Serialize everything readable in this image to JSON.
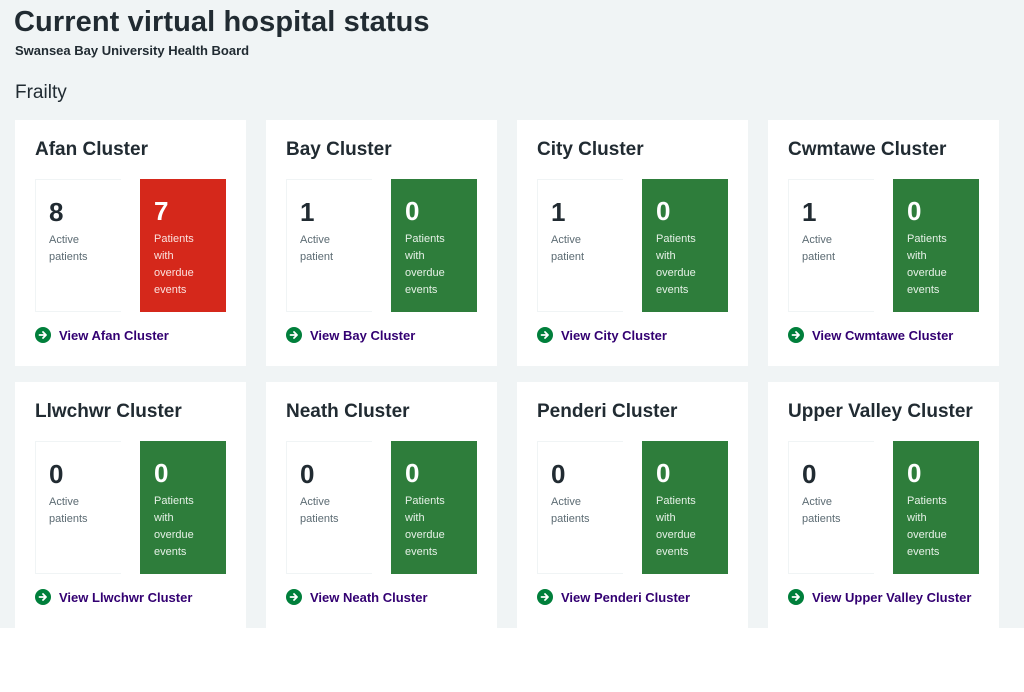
{
  "header": {
    "title": "Current virtual hospital status",
    "subtitle": "Swansea Bay University Health Board",
    "section": "Frailty"
  },
  "colors": {
    "overdue_alert": "#d5281b",
    "overdue_ok": "#2e7d3b",
    "link": "#330072",
    "link_icon": "#007f3b"
  },
  "clusters": [
    {
      "name": "Afan Cluster",
      "active_count": "8",
      "active_label": "Active patients",
      "overdue_count": "7",
      "overdue_label": "Patients with overdue events",
      "status": "alert",
      "link": "View Afan Cluster"
    },
    {
      "name": "Bay Cluster",
      "active_count": "1",
      "active_label": "Active patient",
      "overdue_count": "0",
      "overdue_label": "Patients with overdue events",
      "status": "ok",
      "link": "View Bay Cluster"
    },
    {
      "name": "City Cluster",
      "active_count": "1",
      "active_label": "Active patient",
      "overdue_count": "0",
      "overdue_label": "Patients with overdue events",
      "status": "ok",
      "link": "View City Cluster"
    },
    {
      "name": "Cwmtawe Cluster",
      "active_count": "1",
      "active_label": "Active patient",
      "overdue_count": "0",
      "overdue_label": "Patients with overdue events",
      "status": "ok",
      "link": "View Cwmtawe Cluster"
    },
    {
      "name": "Llwchwr Cluster",
      "active_count": "0",
      "active_label": "Active patients",
      "overdue_count": "0",
      "overdue_label": "Patients with overdue events",
      "status": "ok",
      "link": "View Llwchwr Cluster"
    },
    {
      "name": "Neath Cluster",
      "active_count": "0",
      "active_label": "Active patients",
      "overdue_count": "0",
      "overdue_label": "Patients with overdue events",
      "status": "ok",
      "link": "View Neath Cluster"
    },
    {
      "name": "Penderi Cluster",
      "active_count": "0",
      "active_label": "Active patients",
      "overdue_count": "0",
      "overdue_label": "Patients with overdue events",
      "status": "ok",
      "link": "View Penderi Cluster"
    },
    {
      "name": "Upper Valley Cluster",
      "active_count": "0",
      "active_label": "Active patients",
      "overdue_count": "0",
      "overdue_label": "Patients with overdue events",
      "status": "ok",
      "link": "View Upper Valley Cluster"
    }
  ]
}
